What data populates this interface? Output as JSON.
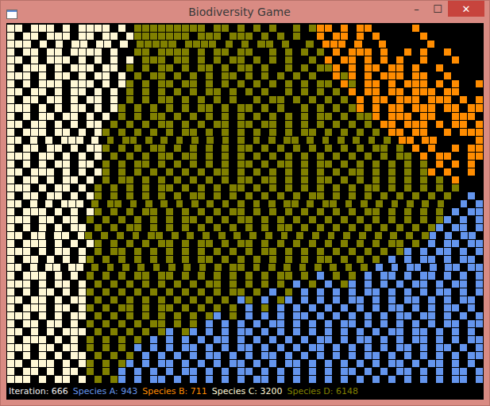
{
  "window": {
    "title": "Biodiversity Game"
  },
  "controls": [
    {
      "label": "–",
      "kind": "minimize"
    },
    {
      "label": "☐",
      "kind": "maximize"
    },
    {
      "label": "✕",
      "kind": "close"
    }
  ],
  "species": [
    {
      "key": "A",
      "label": "Species A: 943",
      "color": "#6495ed"
    },
    {
      "key": "B",
      "label": "Species B: 711",
      "color": "#ff8c00"
    },
    {
      "key": "C",
      "label": "Species C: 3200",
      "color": "#fff8d6"
    },
    {
      "key": "D",
      "label": "Species D: 6148",
      "color": "#808000"
    }
  ],
  "status": {
    "iteration": "Iteration: 666"
  },
  "board": [
    "CC.CCC.C.CCCC.C.DDDDDDDDD.DD.D.D.D..D.DBB.B.BB.....B........",
    "C.CC.CCC.CC.CC.CDDDDDDD.DDD.DDD.D.D.D..B.BB.B.B.....B.......",
    "CCC.C.C.CC.CC.C.DDDDD.DDDD.D.D.DD.D..D.BBB.B..B.....B......",
    "C.CC.CC.CCCC.C..DD.DDDD.D.DD.DD..D.D.D.D.B.BBB.B..B.B..B....",
    "CC.C.CCC.C.C.C.C.DDD.DD.D.D.DD.D.D.D..D.B.BB.B.B.B..B...B...",
    "C.CCC.C.CCC.CC.D.D.DD.D.DD.D.DD.D..D.D.DDB.B.BB.BB.B..B.....",
    "CCC.C.CC.C.CC.C.D.DD.D.D.D.DD.D.D.D.D.D..BDB.B.BBB.BB..B....",
    "C.C.CCC.CCC.C.CD.D.DD.DD.D.D.D.D.D.D.D.DD.BD.BB.B.BBB.B.B..B",
    "CC.CC.C.CC.C.C.D.D.D.D.D.DD.D.D.D..D.D.D.D.B.BB.BB.BBB.BB...",
    "C.CC.CC.C.CC.C.D.D.DD.D.D.D.D..D.DD.D.D.D.D.B.BB.BBB.BBB.B.B",
    "CCC.C.C.CC.C.CD.D.D.D.D.DD.D.DD.D.D..D.D.D.DB.B.BB.BBB.BB.BB",
    "C.C.CC.CC.C.C.D.D.DD.D.D.D.D.D.D.D.D.D.DD.D.DDB.BBB.BB..BBB.",
    "CC.CC.C.C.CC.D.D.D.DD.D.D.DD.DD.DD.D.D.D.D.D.D.BB.BBB.B.BB.B",
    "C.CCC.CC.C.CD.D.D.D.D.DD.D.D.D.D.D.D.DD.D.D.D.D.BB.BB..B.BBB",
    "CC.C.C.CCC.C.D.DD.D.D.D.D.D.D.D.D.D.DD.D.D.D.D.D.D.BB.BB.....B",
    "C.CC.CC.C.CCD.D.D.DD.D.D.D.D.DD.D.D.D.D.D.D.D.DD.D.B.B..B.BB",
    "CCC.CC.C.C.C.D.D.D.DD.DD.D.D.D.D.D.D.D.D.D.D.D.D.DD.B.BB..BB",
    "C.C.C.CC.CC.D.D.DD.D.D.D.D.D.DD.D.DD.D.DD.D.D.D.D.D.D.B.B.B.",
    "CC.CCC.C.C.CD.D.D.D.D.D.D.DD.D.D.D.D.D.D.D.DD.D.D.D.DB.B..B.",
    "C.CC.C.CC.C.D.DD.D.D.D.D.D.D.DD.DD.D.D.DD.D.D.D.D.D.D.D.B...",
    "CCC.C.CC.C.D.D.D.D.DD.D.D.D.DD.D.D.D.D.D.D.D.DD.D.D.D.D.D...",
    "C.CC.CC.C.CD.D.D.D.D.D.DD.D.D.D.D.D.D.DD.D.D.D.D.D.D.D.D..A.",
    "CC.C.C.CCC.D.DD.D.D.D.D.D.D.D.D.D.D.DD.D.DD.D.D.D.D.D.D.D..A.A",
    "C.CCC.C.C.CD.D.D.DD.D.D.D.D.DD.D.D.D.D.D.D.D.DD.D.D.D.D.A.AA",
    "CCC.CC.CC.D.D.D.D.D.D.DD.D.D.DD.D.D.D.D.D.D.D.D.D.D.D.DA.A.A",
    "C.C.C.C.CC.D.D.DD.D.D.D.D.D.D.D.D.DD.D.D.D.D.D.D.D.D.DA.AA.A",
    "CC.CC.CC.CD.D.D.D.DD.D.D.D.D.D.D.D.D.D.D.D.D.D.D.D.D.DA.A.AA.",
    "C.CCC.C.C.CD.D.D.D.DD.D.DD.D.DD.D.D.D.D.D.D.D.D.DD.D.A.AA.AA",
    "CCC.C.CC.C.D.DD.D.D.D.D.D.D.D.D.DD.D.D.D.D.D.D.D.DA.A.AA.A.A",
    "C.CC.C.C.CD.D.D.D.D.D.D.DD.D.D.D.D.D.D.DD.D.D.D.A.A.AA.A.AA.",
    "CC.C.CC.CC.D.D.D.D.D.D.D.D.D.DD.D.D.D.D.D.D.D.D.A.A.AA.A.AA.AA",
    "C.CCC.C.C.D.D.D.DD.DD.D.D.D.D.D.D.DD.D.A.D.D.A.AA.A.AA.A.A.A",
    "CCC.C.CC.C.D.D.D.D.D.D.D.DD.D.D.D.D.A.D.A.DA.A.A.A.AA.A.AA.A",
    "C.C.CC.C.CD.D.D.D.D.D.D.D.D.DD.D.A.D.A.A.A.A.AA.A.A.A.AA.A.A",
    "CC.CC.C.CC.D.D.D.D.D.D.D.D.D.AD.A.DA.A.A.A.AA.A.A.AA.A.A.AA.",
    "C.CCC.CC.CD.D.DD.D.DD.D.D.D.D.A.D.A.A.A.A.A.A.A.AA.A.A.AA.A.",
    "CCC.C.C.CC.D.D.D.D.D.D.D.DA.D.A.A.A.AA.A.A.A.A.A.AA.AA.A.A.A",
    "C.CC.CC.C.D.D.D.D.DD.D.D.A.A.A.A.AA.A.A.A.AA.A.A.A.A.A.AA.AA",
    "CC.C.C.CCC.D.D.D.D.DA.DA.A.A.AA.A.A.A.A.A.A.A.A.AA.AA.A.A.A.",
    "C.CCC.C.C.D.D.D.D.A.A.A.A.AA.A.A.A.A.A.AA.A.AA.A.A.AA.A.A.AA",
    "CCC.CC.CC.D.D.D.A.A.A.AA.A.A.AA.A.A.A.AA.A.A.A.A.AA.A.AA.A.A",
    "C.C.C.C.CC.D.D.D.A.A.A.A.AA.A.A.AA.A.A.A.A.A.AA.A.A.A.A.A.AA",
    "CC.CCC.C.CD.D.DA.A.AA.A.A.A.AA.A.A.AA.A.A.A.A.A.AA.A.AA.A.A.",
    "C.CC.C.CC.D.D.A.A.A.A.AA.A.A.AA.A.A.A.A.A.AA.A.A.AA.A.A.AA.A",
    "CCC.C.CC.C.D.DA.A.AA.A.A.A.A.A.AA.A.A.A.A.A.A.A.A.A.A.A.AA.A"
  ]
}
